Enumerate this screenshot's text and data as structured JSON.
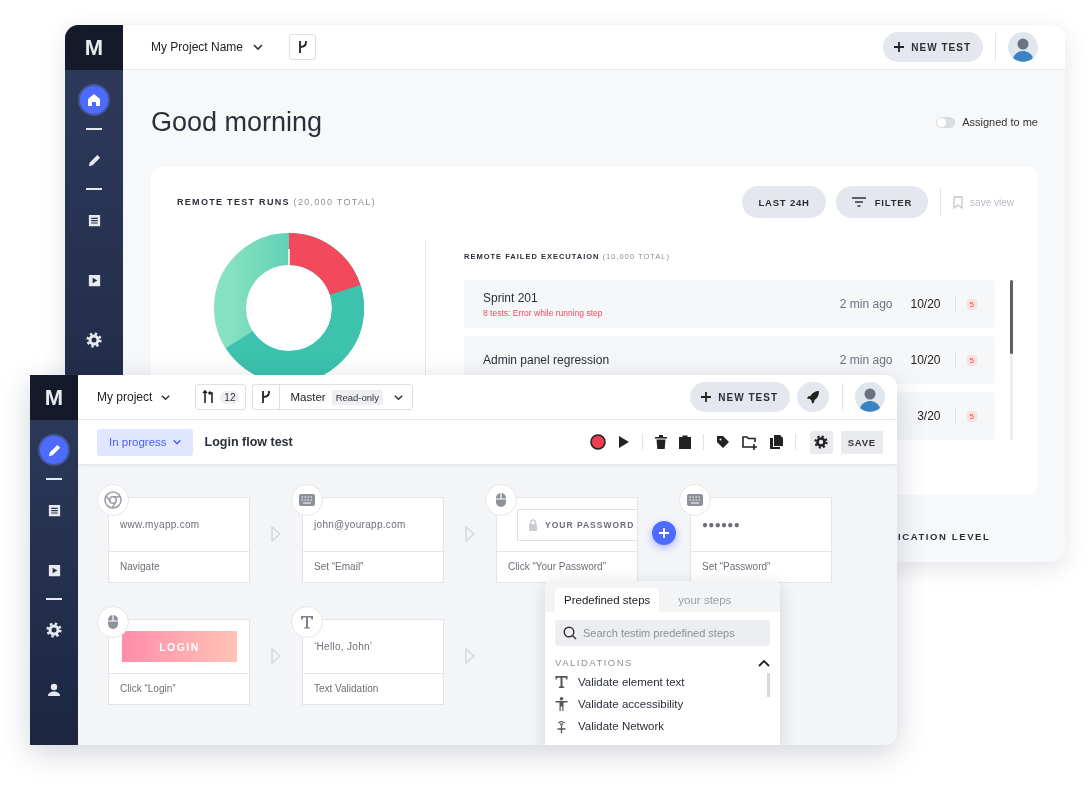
{
  "back_window": {
    "logo": "M",
    "sidebar": {
      "items": [
        {
          "kind": "home",
          "selected": true,
          "separator": true
        },
        {
          "kind": "pencil",
          "selected": false,
          "separator": true
        },
        {
          "kind": "list",
          "selected": false,
          "separator": false
        },
        {
          "kind": "play",
          "selected": false,
          "separator": false
        },
        {
          "kind": "gear",
          "selected": false,
          "separator": false
        }
      ]
    },
    "project": "My Project Name",
    "new_test": "NEW TEST",
    "greeting": "Good morning",
    "assigned_toggle": {
      "label": "Assigned to me",
      "on": false
    },
    "runs_card": {
      "title": "REMOTE TEST RUNS",
      "total": "(20,000 TOTAL)",
      "range_button": "LAST 24H",
      "filter_button": "FILTER",
      "save_view": "save view"
    },
    "failed": {
      "title": "REMOTE FAILED EXECUTAION",
      "total": "(10,000 TOTAL)",
      "rows": [
        {
          "name": "Sprint 201",
          "error": "8 tests: Error while running step",
          "time": "2 min ago",
          "count": "10/20",
          "badge": "5"
        },
        {
          "name": "Admin panel regression",
          "time": "2 min ago",
          "count": "10/20",
          "badge": "5"
        },
        {
          "count": "3/20",
          "badge": "5"
        }
      ]
    },
    "section_label": "ICATION LEVEL"
  },
  "front_window": {
    "logo": "M",
    "sidebar": {
      "items": [
        {
          "kind": "pencil",
          "selected": true,
          "separator": true
        },
        {
          "kind": "list",
          "selected": false,
          "separator": false
        },
        {
          "kind": "play",
          "selected": false,
          "separator": true
        },
        {
          "kind": "gear",
          "selected": false,
          "separator": false
        },
        {
          "kind": "user",
          "selected": false,
          "separator": false
        }
      ]
    },
    "project": "My project",
    "pull_requests": "12",
    "branch": "Master",
    "branch_tag": "Read-only",
    "new_test": "NEW TEST",
    "status": "In progress",
    "test_name": "Login flow test",
    "save": "SAVE",
    "steps": [
      [
        {
          "kind": "browser",
          "value": {
            "kind": "text",
            "text": "www.myapp.com"
          },
          "label": "Navigate"
        },
        {
          "kind": "arrow"
        },
        {
          "kind": "keyboard",
          "value": {
            "kind": "text",
            "text": "john@yourapp.com"
          },
          "label": "Set “Email”"
        },
        {
          "kind": "arrow"
        },
        {
          "kind": "mouse",
          "value": {
            "kind": "field",
            "text": "YOUR PASSWORD"
          },
          "label": "Click “Your Password”"
        },
        {
          "kind": "add"
        },
        {
          "kind": "keyboard",
          "value": {
            "kind": "text",
            "text": "●●●●●●"
          },
          "label": "Set “Password”"
        }
      ],
      [
        {
          "kind": "mouse",
          "value": {
            "kind": "button",
            "text": "LOGIN"
          },
          "label": "Click “Login”"
        },
        {
          "kind": "arrow"
        },
        {
          "kind": "text",
          "value": {
            "kind": "text",
            "text": "‘Hello, John’"
          },
          "label": "Text Validation"
        },
        {
          "kind": "arrow"
        }
      ]
    ],
    "popup": {
      "tabs": [
        {
          "label": "Predefined steps",
          "selected": true
        },
        {
          "label": "your steps",
          "selected": false
        }
      ],
      "search_placeholder": "Search testim predefined steps",
      "section": "VALIDATIONS",
      "expanded": true,
      "items": [
        {
          "kind": "text",
          "label": "Validate element text"
        },
        {
          "kind": "accessibility",
          "label": "Validate accessibility"
        },
        {
          "kind": "network",
          "label": "Validate Network"
        }
      ]
    }
  }
}
